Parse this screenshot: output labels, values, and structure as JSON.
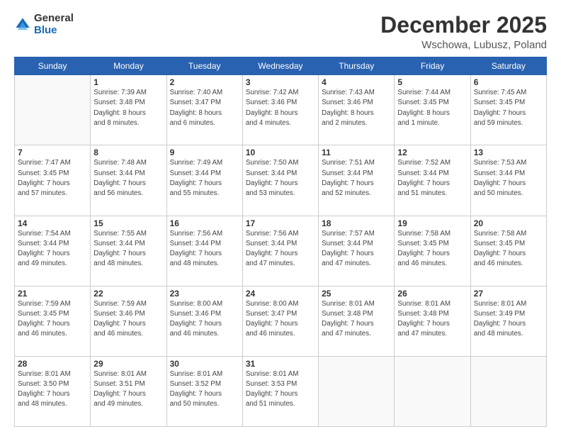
{
  "logo": {
    "general": "General",
    "blue": "Blue"
  },
  "header": {
    "title": "December 2025",
    "subtitle": "Wschowa, Lubusz, Poland"
  },
  "weekdays": [
    "Sunday",
    "Monday",
    "Tuesday",
    "Wednesday",
    "Thursday",
    "Friday",
    "Saturday"
  ],
  "weeks": [
    [
      {
        "day": "",
        "empty": true
      },
      {
        "day": "1",
        "sunrise": "Sunrise: 7:39 AM",
        "sunset": "Sunset: 3:48 PM",
        "daylight": "Daylight: 8 hours",
        "daylight2": "and 8 minutes."
      },
      {
        "day": "2",
        "sunrise": "Sunrise: 7:40 AM",
        "sunset": "Sunset: 3:47 PM",
        "daylight": "Daylight: 8 hours",
        "daylight2": "and 6 minutes."
      },
      {
        "day": "3",
        "sunrise": "Sunrise: 7:42 AM",
        "sunset": "Sunset: 3:46 PM",
        "daylight": "Daylight: 8 hours",
        "daylight2": "and 4 minutes."
      },
      {
        "day": "4",
        "sunrise": "Sunrise: 7:43 AM",
        "sunset": "Sunset: 3:46 PM",
        "daylight": "Daylight: 8 hours",
        "daylight2": "and 2 minutes."
      },
      {
        "day": "5",
        "sunrise": "Sunrise: 7:44 AM",
        "sunset": "Sunset: 3:45 PM",
        "daylight": "Daylight: 8 hours",
        "daylight2": "and 1 minute."
      },
      {
        "day": "6",
        "sunrise": "Sunrise: 7:45 AM",
        "sunset": "Sunset: 3:45 PM",
        "daylight": "Daylight: 7 hours",
        "daylight2": "and 59 minutes."
      }
    ],
    [
      {
        "day": "7",
        "sunrise": "Sunrise: 7:47 AM",
        "sunset": "Sunset: 3:45 PM",
        "daylight": "Daylight: 7 hours",
        "daylight2": "and 57 minutes."
      },
      {
        "day": "8",
        "sunrise": "Sunrise: 7:48 AM",
        "sunset": "Sunset: 3:44 PM",
        "daylight": "Daylight: 7 hours",
        "daylight2": "and 56 minutes."
      },
      {
        "day": "9",
        "sunrise": "Sunrise: 7:49 AM",
        "sunset": "Sunset: 3:44 PM",
        "daylight": "Daylight: 7 hours",
        "daylight2": "and 55 minutes."
      },
      {
        "day": "10",
        "sunrise": "Sunrise: 7:50 AM",
        "sunset": "Sunset: 3:44 PM",
        "daylight": "Daylight: 7 hours",
        "daylight2": "and 53 minutes."
      },
      {
        "day": "11",
        "sunrise": "Sunrise: 7:51 AM",
        "sunset": "Sunset: 3:44 PM",
        "daylight": "Daylight: 7 hours",
        "daylight2": "and 52 minutes."
      },
      {
        "day": "12",
        "sunrise": "Sunrise: 7:52 AM",
        "sunset": "Sunset: 3:44 PM",
        "daylight": "Daylight: 7 hours",
        "daylight2": "and 51 minutes."
      },
      {
        "day": "13",
        "sunrise": "Sunrise: 7:53 AM",
        "sunset": "Sunset: 3:44 PM",
        "daylight": "Daylight: 7 hours",
        "daylight2": "and 50 minutes."
      }
    ],
    [
      {
        "day": "14",
        "sunrise": "Sunrise: 7:54 AM",
        "sunset": "Sunset: 3:44 PM",
        "daylight": "Daylight: 7 hours",
        "daylight2": "and 49 minutes."
      },
      {
        "day": "15",
        "sunrise": "Sunrise: 7:55 AM",
        "sunset": "Sunset: 3:44 PM",
        "daylight": "Daylight: 7 hours",
        "daylight2": "and 48 minutes."
      },
      {
        "day": "16",
        "sunrise": "Sunrise: 7:56 AM",
        "sunset": "Sunset: 3:44 PM",
        "daylight": "Daylight: 7 hours",
        "daylight2": "and 48 minutes."
      },
      {
        "day": "17",
        "sunrise": "Sunrise: 7:56 AM",
        "sunset": "Sunset: 3:44 PM",
        "daylight": "Daylight: 7 hours",
        "daylight2": "and 47 minutes."
      },
      {
        "day": "18",
        "sunrise": "Sunrise: 7:57 AM",
        "sunset": "Sunset: 3:44 PM",
        "daylight": "Daylight: 7 hours",
        "daylight2": "and 47 minutes."
      },
      {
        "day": "19",
        "sunrise": "Sunrise: 7:58 AM",
        "sunset": "Sunset: 3:45 PM",
        "daylight": "Daylight: 7 hours",
        "daylight2": "and 46 minutes."
      },
      {
        "day": "20",
        "sunrise": "Sunrise: 7:58 AM",
        "sunset": "Sunset: 3:45 PM",
        "daylight": "Daylight: 7 hours",
        "daylight2": "and 46 minutes."
      }
    ],
    [
      {
        "day": "21",
        "sunrise": "Sunrise: 7:59 AM",
        "sunset": "Sunset: 3:45 PM",
        "daylight": "Daylight: 7 hours",
        "daylight2": "and 46 minutes."
      },
      {
        "day": "22",
        "sunrise": "Sunrise: 7:59 AM",
        "sunset": "Sunset: 3:46 PM",
        "daylight": "Daylight: 7 hours",
        "daylight2": "and 46 minutes."
      },
      {
        "day": "23",
        "sunrise": "Sunrise: 8:00 AM",
        "sunset": "Sunset: 3:46 PM",
        "daylight": "Daylight: 7 hours",
        "daylight2": "and 46 minutes."
      },
      {
        "day": "24",
        "sunrise": "Sunrise: 8:00 AM",
        "sunset": "Sunset: 3:47 PM",
        "daylight": "Daylight: 7 hours",
        "daylight2": "and 46 minutes."
      },
      {
        "day": "25",
        "sunrise": "Sunrise: 8:01 AM",
        "sunset": "Sunset: 3:48 PM",
        "daylight": "Daylight: 7 hours",
        "daylight2": "and 47 minutes."
      },
      {
        "day": "26",
        "sunrise": "Sunrise: 8:01 AM",
        "sunset": "Sunset: 3:48 PM",
        "daylight": "Daylight: 7 hours",
        "daylight2": "and 47 minutes."
      },
      {
        "day": "27",
        "sunrise": "Sunrise: 8:01 AM",
        "sunset": "Sunset: 3:49 PM",
        "daylight": "Daylight: 7 hours",
        "daylight2": "and 48 minutes."
      }
    ],
    [
      {
        "day": "28",
        "sunrise": "Sunrise: 8:01 AM",
        "sunset": "Sunset: 3:50 PM",
        "daylight": "Daylight: 7 hours",
        "daylight2": "and 48 minutes."
      },
      {
        "day": "29",
        "sunrise": "Sunrise: 8:01 AM",
        "sunset": "Sunset: 3:51 PM",
        "daylight": "Daylight: 7 hours",
        "daylight2": "and 49 minutes."
      },
      {
        "day": "30",
        "sunrise": "Sunrise: 8:01 AM",
        "sunset": "Sunset: 3:52 PM",
        "daylight": "Daylight: 7 hours",
        "daylight2": "and 50 minutes."
      },
      {
        "day": "31",
        "sunrise": "Sunrise: 8:01 AM",
        "sunset": "Sunset: 3:53 PM",
        "daylight": "Daylight: 7 hours",
        "daylight2": "and 51 minutes."
      },
      {
        "day": "",
        "empty": true
      },
      {
        "day": "",
        "empty": true
      },
      {
        "day": "",
        "empty": true
      }
    ]
  ]
}
